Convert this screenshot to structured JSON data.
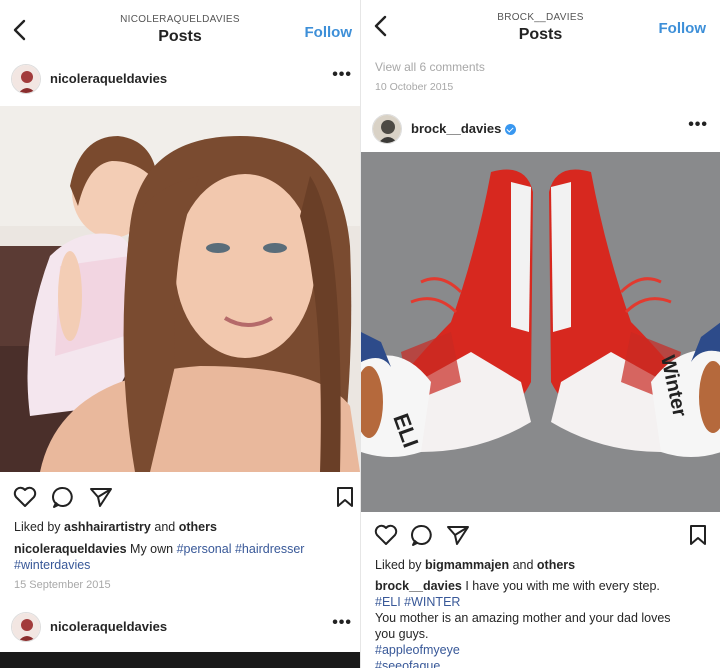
{
  "left": {
    "header": {
      "username": "NICOLERAQUELDAVIES",
      "title": "Posts",
      "follow": "Follow"
    },
    "post": {
      "username": "nicoleraqueldavies",
      "more": "•••",
      "liked_by_prefix": "Liked by ",
      "liked_by_user": "ashhairartistry",
      "liked_by_mid": " and ",
      "liked_by_others": "others",
      "caption_user": "nicoleraqueldavies",
      "caption_text": " My own ",
      "tag1": "#personal",
      "tag2": "#hairdresser",
      "tag3": "#winterdavies",
      "date": "15 September 2015"
    },
    "next_post": {
      "username": "nicoleraqueldavies",
      "more": "•••"
    }
  },
  "right": {
    "header": {
      "username": "BROCK__DAVIES",
      "title": "Posts",
      "follow": "Follow"
    },
    "prev_post": {
      "comments": "View all 6 comments",
      "date": "10 October 2015"
    },
    "post": {
      "username": "brock__davies",
      "more": "•••",
      "liked_by_prefix": "Liked by ",
      "liked_by_user": "bigmammajen",
      "liked_by_mid": " and ",
      "liked_by_others": "others",
      "caption_user": "brock__davies",
      "caption_text": " I have you with me with every step.",
      "tags_line": "#ELI #WINTER",
      "line3": "You mother is an amazing mother and your dad loves",
      "line4": "you guys.",
      "tag_apple": "#appleofmyeye",
      "tag_last": "#seeofague"
    },
    "shoe_text_left": "ELI",
    "shoe_text_right": "Winter"
  }
}
